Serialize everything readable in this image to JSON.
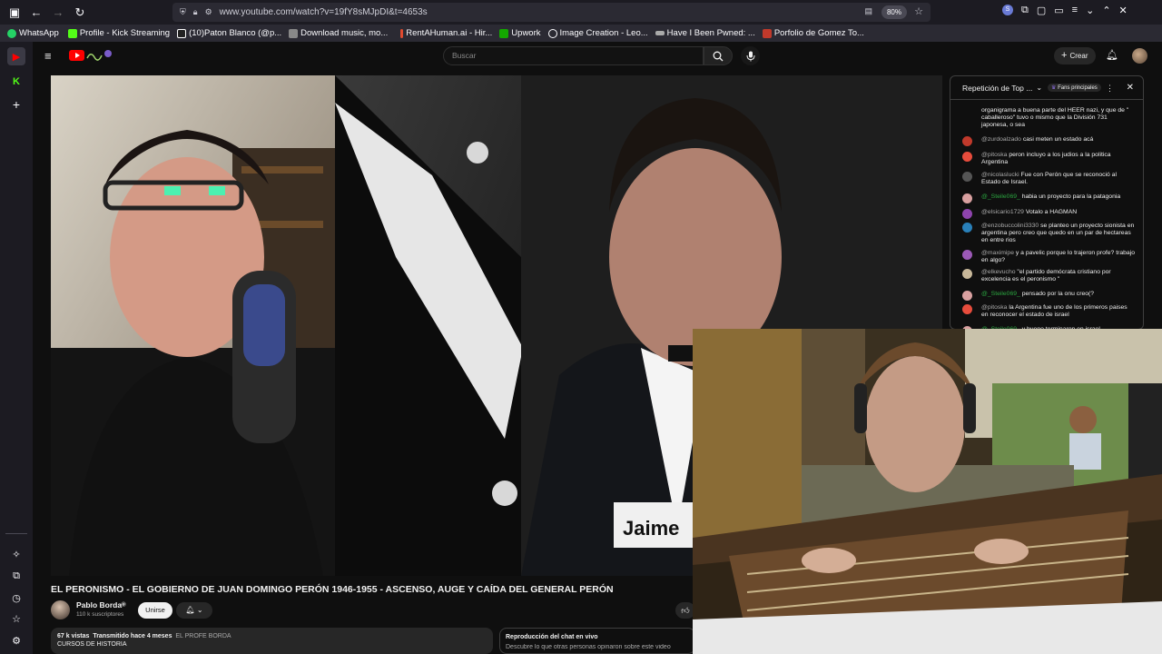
{
  "browser": {
    "url": "www.youtube.com/watch?v=19fY8sMJpDI&t=4653s",
    "zoom": "80%",
    "bookmarks": [
      {
        "label": "WhatsApp",
        "color": "#25d366"
      },
      {
        "label": "Profile - Kick Streaming",
        "color": "#53fc18"
      },
      {
        "label": "(10)Paton Blanco (@p...",
        "color": "#ffffff"
      },
      {
        "label": "Download music, mo...",
        "color": "#cccccc"
      },
      {
        "label": "RentAHuman.ai - Hir...",
        "color": "#e04a2f"
      },
      {
        "label": "Upwork",
        "color": "#14a800"
      },
      {
        "label": "Image Creation - Leo...",
        "color": "#7f7fff"
      },
      {
        "label": "Have I Been Pwned: ...",
        "color": "#cccccc"
      },
      {
        "label": "Porfolio de Gomez To...",
        "color": "#c0392b"
      }
    ]
  },
  "youtube": {
    "search_placeholder": "Buscar",
    "create_label": "Crear",
    "video_overlay_text": "Jaime",
    "video_title": "EL PERONISMO - EL GOBIERNO DE JUAN DOMINGO PERÓN 1946-1955 - ASCENSO, AUGE Y CAÍDA DEL GENERAL PERÓN",
    "channel_name": "Pablo Borda",
    "subscribers": "110 k suscriptores",
    "join_label": "Unirse",
    "views": "67 k vistas",
    "streamed": "Transmitido hace 4 meses",
    "channel_tag": "EL PROFE BORDA",
    "course": "CURSOS DE HISTORIA",
    "replay_title": "Reproducción del chat en vivo",
    "replay_sub": "Descubre lo que otras personas opinaron sobre este video"
  },
  "chat": {
    "header": "Repetición de Top ...",
    "fans_label": "Fans principales",
    "messages": [
      {
        "user": "",
        "text": "organigrama a buena parte del HEER nazi, y que de \" caballeroso\" tuvo o mismo que la División 731 japonesa, o sea",
        "avatar": "#000000",
        "green": false
      },
      {
        "user": "@zurdoalzado",
        "text": "casi meten un estado acá",
        "avatar": "#c0392b",
        "green": false
      },
      {
        "user": "@pitoska",
        "text": "peron incluyo a los judios a la politica Argentina",
        "avatar": "#e74c3c",
        "green": false
      },
      {
        "user": "@nicolaslucki",
        "text": "Fue con Perón que se reconoció al Estado de Israel.",
        "avatar": "#555555",
        "green": false
      },
      {
        "user": "@_Steile069_",
        "text": "habia un proyecto para la patagonia",
        "avatar": "#d9a0a0",
        "green": true
      },
      {
        "user": "@elsicario1729",
        "text": "Votalo a HAGMAN",
        "avatar": "#8e44ad",
        "green": false
      },
      {
        "user": "@enzobuccolini3330",
        "text": "se planteo un proyecto sionista en argentina pero creo que quedo en un par de hectareas en entre rios",
        "avatar": "#2980b9",
        "green": false
      },
      {
        "user": "@maximipe",
        "text": "y a pavelic porque lo trajeron profe? trabajo en algo?",
        "avatar": "#9b59b6",
        "green": false
      },
      {
        "user": "@elkevucho",
        "text": "\"el partido demócrata cristiano por excelencia es el peronismo \"",
        "avatar": "#c8b89a",
        "green": false
      },
      {
        "user": "@_Steile069_",
        "text": "pensado por la onu creo(?",
        "avatar": "#d9a0a0",
        "green": true
      },
      {
        "user": "@pitoska",
        "text": "la Argentina fue uno de los primeros paises en reconocer el estado de israel",
        "avatar": "#e74c3c",
        "green": false
      },
      {
        "user": "@_Steile069_",
        "text": "y bueno terminaron en israel",
        "avatar": "#d9a0a0",
        "green": true
      }
    ]
  }
}
